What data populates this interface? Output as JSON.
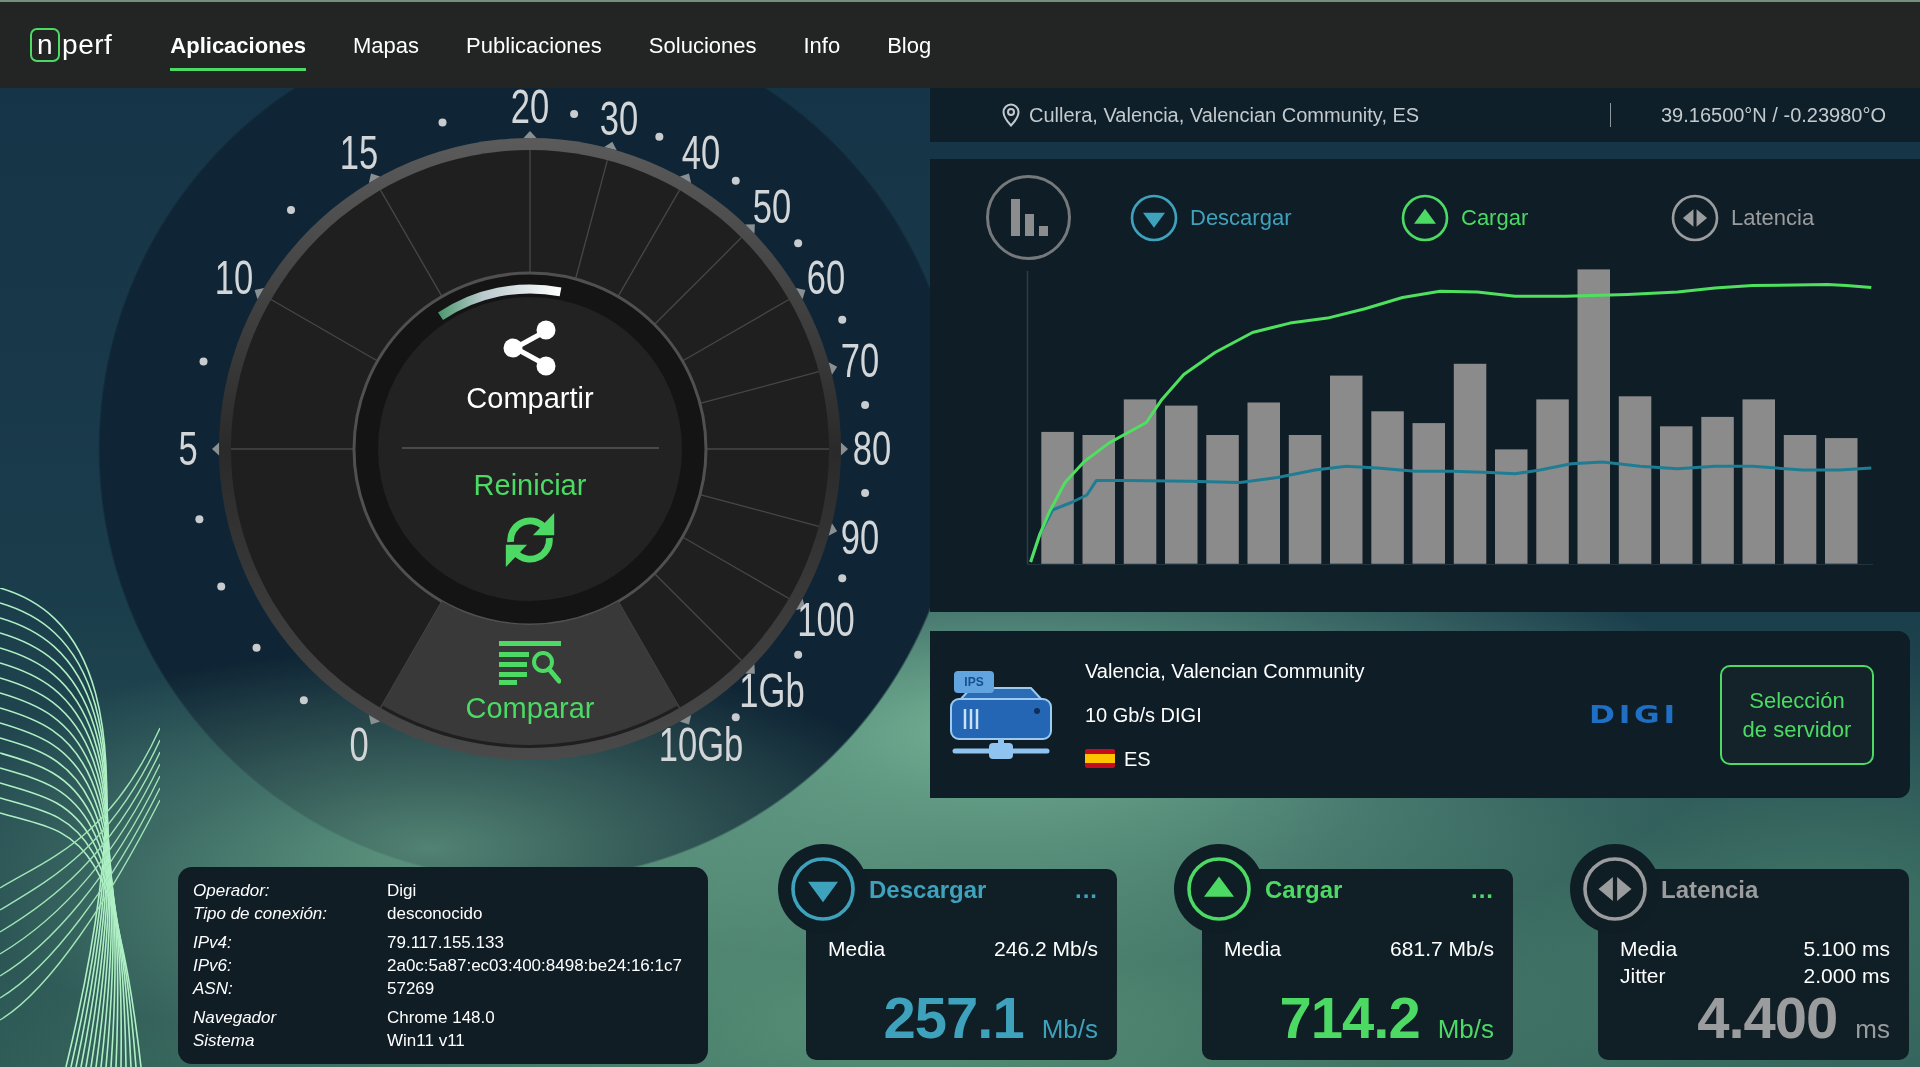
{
  "nav": {
    "logo": {
      "mark": "n",
      "text": "perf"
    },
    "items": [
      {
        "label": "Aplicaciones",
        "selected": true
      },
      {
        "label": "Mapas",
        "selected": false
      },
      {
        "label": "Publicaciones",
        "selected": false
      },
      {
        "label": "Soluciones",
        "selected": false
      },
      {
        "label": "Info",
        "selected": false
      },
      {
        "label": "Blog",
        "selected": false
      }
    ]
  },
  "location": {
    "place": "Cullera, Valencia, Valencian Community, ES",
    "coordinates": "39.16500°N / -0.23980°O"
  },
  "gauge": {
    "scale": [
      "0",
      "5",
      "10",
      "15",
      "20",
      "30",
      "40",
      "50",
      "60",
      "70",
      "80",
      "90",
      "100",
      "1Gb",
      "10Gb"
    ],
    "share": "Compartir",
    "restart": "Reiniciar",
    "compare": "Comparar"
  },
  "chart": {
    "legend": [
      {
        "kind": "download",
        "label": "Descargar",
        "color": "#3fa2bd"
      },
      {
        "kind": "upload",
        "label": "Cargar",
        "color": "#4cd964"
      },
      {
        "kind": "latency",
        "label": "Latencia",
        "color": "#9a9c9e"
      }
    ]
  },
  "server": {
    "tag": "IPS",
    "name": "Valencia, Valencian Community",
    "capacity": "10 Gb/s DIGI",
    "country": "ES",
    "provider_logo": "DIGI",
    "select_button": "Selección de servidor"
  },
  "connection": {
    "groups": [
      {
        "rows": [
          {
            "label": "Operador:",
            "value": "Digi"
          },
          {
            "label": "Tipo de conexión:",
            "value": "desconocido"
          }
        ]
      },
      {
        "rows": [
          {
            "label": "IPv4:",
            "value": "79.117.155.133"
          },
          {
            "label": "IPv6:",
            "value": "2a0c:5a87:ec03:400:8498:be24:16:1c7"
          },
          {
            "label": "ASN:",
            "value": "57269"
          }
        ]
      },
      {
        "rows": [
          {
            "label": "Navegador",
            "value": "Chrome 148.0"
          },
          {
            "label": "Sistema",
            "value": "Win11 v11"
          }
        ]
      }
    ]
  },
  "results": [
    {
      "kind": "download",
      "title": "Descargar",
      "color": "#3fa2bd",
      "menu": "...",
      "stats": [
        {
          "label": "Media",
          "value": "246.2 Mb/s"
        }
      ],
      "value": "257.1",
      "unit": "Mb/s"
    },
    {
      "kind": "upload",
      "title": "Cargar",
      "color": "#4cd964",
      "menu": "...",
      "stats": [
        {
          "label": "Media",
          "value": "681.7 Mb/s"
        }
      ],
      "value": "714.2",
      "unit": "Mb/s"
    },
    {
      "kind": "latency",
      "title": "Latencia",
      "color": "#9a9c9e",
      "stats": [
        {
          "label": "Media",
          "value": "5.100 ms"
        },
        {
          "label": "Jitter",
          "value": "2.000 ms"
        }
      ],
      "value": "4.400",
      "unit": "ms"
    }
  ]
}
